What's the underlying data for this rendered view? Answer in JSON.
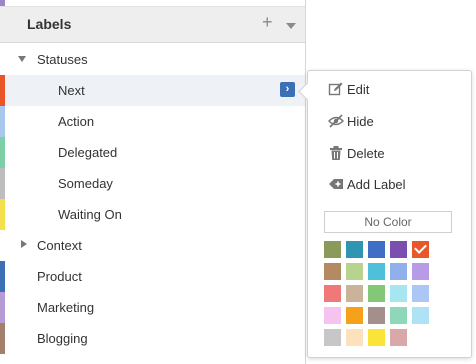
{
  "labels_panel": {
    "title": "Labels",
    "items": [
      {
        "label": "Statuses",
        "color": "#ffffff",
        "indent": 0,
        "expander": "down"
      },
      {
        "label": "Next",
        "color": "#e8562a",
        "indent": 1,
        "selected": true
      },
      {
        "label": "Action",
        "color": "#a8c7ef",
        "indent": 1
      },
      {
        "label": "Delegated",
        "color": "#7fcfa6",
        "indent": 1
      },
      {
        "label": "Someday",
        "color": "#bdbdbd",
        "indent": 1
      },
      {
        "label": "Waiting On",
        "color": "#f4e04d",
        "indent": 1
      },
      {
        "label": "Context",
        "color": "#ffffff",
        "indent": 0,
        "expander": "right"
      },
      {
        "label": "Product",
        "color": "#3b6fb6",
        "indent": 0
      },
      {
        "label": "Marketing",
        "color": "#b79bd6",
        "indent": 0
      },
      {
        "label": "Blogging",
        "color": "#a47f6c",
        "indent": 0
      }
    ]
  },
  "menu": {
    "items": [
      {
        "label": "Edit",
        "icon": "edit-icon"
      },
      {
        "label": "Hide",
        "icon": "hide-icon"
      },
      {
        "label": "Delete",
        "icon": "trash-icon"
      },
      {
        "label": "Add Label",
        "icon": "add-label-icon"
      }
    ],
    "no_color_label": "No Color",
    "selected_color": "#e8562a",
    "palette": [
      [
        "#8a9a5b",
        "#2e95b3",
        "#3e6fc5",
        "#7a4fb0",
        "#e8562a"
      ],
      [
        "#b48a62",
        "#b7d38e",
        "#4fc0d9",
        "#8fb0ea",
        "#b79be6"
      ],
      [
        "#f17878",
        "#c9b39a",
        "#84c776",
        "#a6e6f0",
        "#acc7f5"
      ],
      [
        "#f6c2f0",
        "#f6a11a",
        "#a3908d",
        "#8ed7b9",
        "#aee3f5"
      ],
      [
        "#c7c7c7",
        "#fde1bd",
        "#fbe43a",
        "#d9a8a8"
      ]
    ]
  }
}
